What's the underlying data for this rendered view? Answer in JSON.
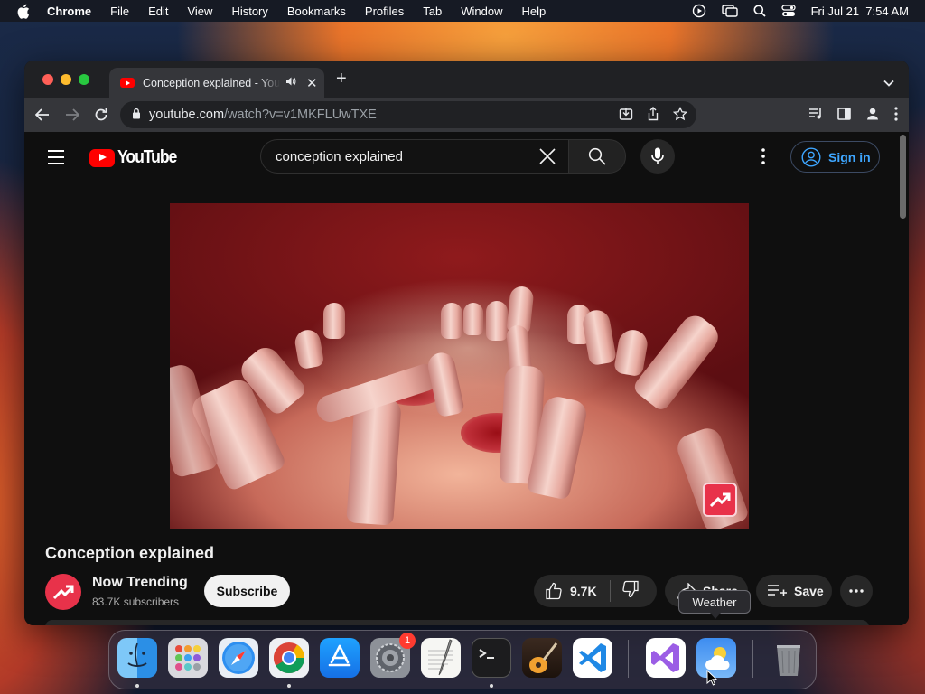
{
  "menubar": {
    "items": [
      "Chrome",
      "File",
      "Edit",
      "View",
      "History",
      "Bookmarks",
      "Profiles",
      "Tab",
      "Window",
      "Help"
    ],
    "clock": "Fri Jul 21  7:54 AM"
  },
  "browser": {
    "tab_title": "Conception explained - YouTube",
    "url_host": "youtube.com",
    "url_path": "/watch?v=v1MKFLUwTXE"
  },
  "youtube": {
    "logo_text": "YouTube",
    "search_value": "conception explained",
    "sign_in": "Sign in",
    "video_title": "Conception explained",
    "channel_name": "Now Trending",
    "channel_subs": "83.7K subscribers",
    "subscribe": "Subscribe",
    "likes": "9.7K",
    "share": "Share",
    "save": "Save"
  },
  "dock": {
    "tooltip": "Weather",
    "settings_badge": "1",
    "apps": [
      "Finder",
      "Launchpad",
      "Safari",
      "Chrome",
      "App Store",
      "System Settings",
      "TextEdit",
      "Terminal",
      "GarageBand",
      "Visual Studio Code",
      "Visual Studio",
      "Weather",
      "Trash"
    ]
  },
  "colors": {
    "youtube_red": "#ff0000",
    "link_blue": "#3ea6ff",
    "badge_red": "#ff3b30"
  }
}
